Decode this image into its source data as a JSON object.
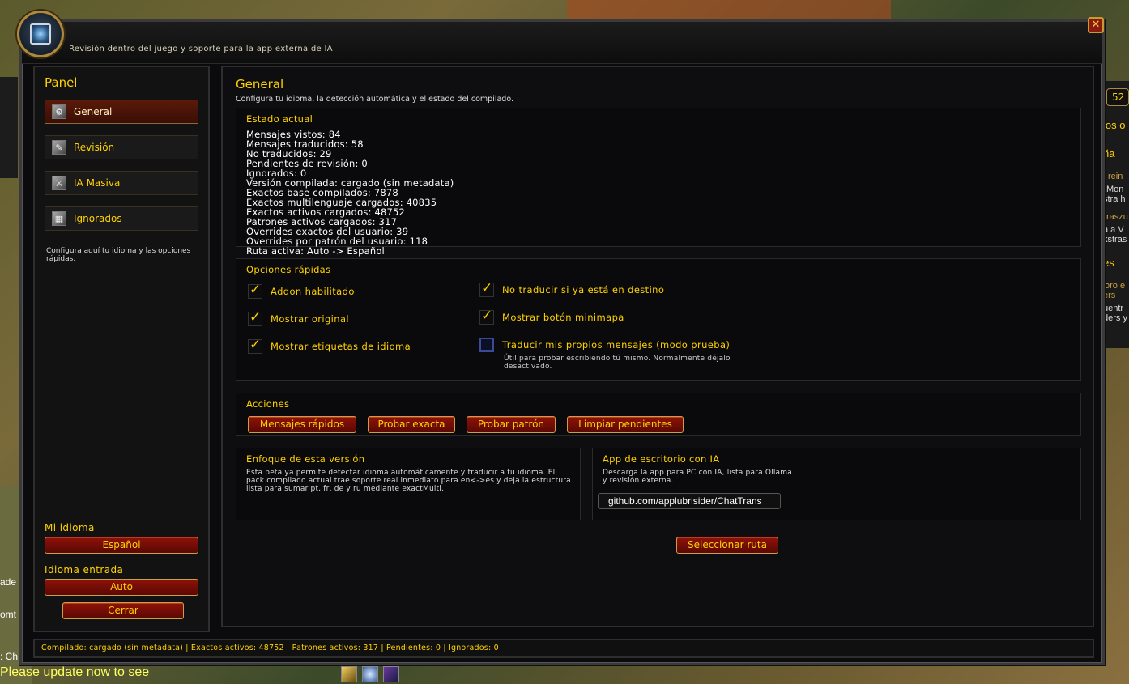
{
  "window": {
    "subtitle": "Revisión dentro del juego y soporte para la app externa de IA",
    "close_symbol": "✕"
  },
  "sidebar": {
    "title": "Panel",
    "items": [
      {
        "label": "General",
        "icon": "gear-icon",
        "active": true
      },
      {
        "label": "Revisión",
        "icon": "quill-icon",
        "active": false
      },
      {
        "label": "IA Masiva",
        "icon": "sword-icon",
        "active": false
      },
      {
        "label": "Ignorados",
        "icon": "grid-icon",
        "active": false
      }
    ],
    "help": "Configura aquí tu idioma y las opciones rápidas.",
    "my_language_label": "Mi idioma",
    "my_language_value": "Español",
    "input_language_label": "Idioma entrada",
    "input_language_value": "Auto",
    "close_label": "Cerrar"
  },
  "main": {
    "title": "General",
    "subtitle": "Configura tu idioma, la detección automática y el estado del compilado.",
    "status": {
      "title": "Estado actual",
      "lines": [
        "Mensajes vistos: 84",
        "Mensajes traducidos: 58",
        "No traducidos: 29",
        "Pendientes de revisión: 0",
        "Ignorados: 0",
        "Versión compilada: cargado (sin metadata)",
        "Exactos base compilados: 7878",
        "Exactos multilenguaje cargados: 40835",
        "Exactos activos cargados: 48752",
        "Patrones activos cargados: 317",
        "Overrides exactos del usuario: 39",
        "Overrides por patrón del usuario: 118",
        "Ruta activa: Auto -> Español"
      ]
    },
    "quick": {
      "title": "Opciones rápidas",
      "options": [
        {
          "label": "Addon habilitado",
          "checked": true
        },
        {
          "label": "Mostrar original",
          "checked": true
        },
        {
          "label": "Mostrar etiquetas de idioma",
          "checked": true
        },
        {
          "label": "No traducir si ya está en destino",
          "checked": true
        },
        {
          "label": "Mostrar botón minimapa",
          "checked": true
        },
        {
          "label": "Traducir mis propios mensajes (modo prueba)",
          "checked": false
        }
      ],
      "note": "Útil para probar escribiendo tú mismo. Normalmente déjalo desactivado."
    },
    "actions": {
      "title": "Acciones",
      "buttons": [
        "Mensajes rápidos",
        "Probar exacta",
        "Probar patrón",
        "Limpiar pendientes"
      ]
    },
    "focus": {
      "title": "Enfoque de esta versión",
      "text": "Esta beta ya permite detectar idioma automáticamente y traducir a tu idioma. El pack compilado actual trae soporte real inmediato para en<->es y deja la estructura lista para sumar pt, fr, de y ru mediante exactMulti."
    },
    "desktop": {
      "title": "App de escritorio con IA",
      "text": "Descarga la app para PC con IA, lista para Ollama y revisión externa.",
      "url": "github.com/applubrisider/ChatTrans",
      "select_label": "Seleccionar ruta"
    }
  },
  "statusbar": {
    "text": "Compilado: cargado (sin metadata) | Exactos activos: 48752 | Patrones activos: 317 | Pendientes: 0 | Ignorados: 0"
  },
  "background": {
    "warning": "Please update now to see",
    "left_fragments": [
      "ade",
      "omt",
      ": Ch"
    ],
    "right_fragments": [
      "52",
      "los o",
      "ña",
      "rein",
      "Mon",
      "stra h",
      "raszu",
      "a a V",
      "kstras",
      "es",
      "oro e",
      "ers",
      "uentr",
      "ders y"
    ]
  },
  "colors": {
    "accent_gold": "#ffd100",
    "button_red": "#8e1208",
    "panel_bg": "#0e0e10"
  }
}
